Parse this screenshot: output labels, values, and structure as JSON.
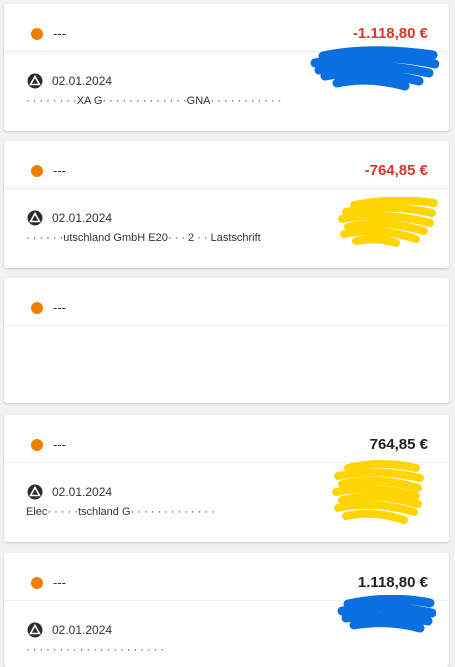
{
  "colors": {
    "status_dot": "#ef7d00",
    "negative": "#d9342b",
    "positive": "#222222",
    "redaction_blue": "#0a6fe0",
    "redaction_yellow": "#ffd400"
  },
  "transactions": [
    {
      "description": "---",
      "amount": "-1.118,80 €",
      "sign": "negative",
      "date": "02.01.2024",
      "bank_icon": "sparkasse-logo-icon",
      "subtext": "· · · · · ·  · ·XA G·  ·  ·  · · ·  ·  ·  ·  · ·  · ·GNA·  ·  ·  · ·  ·  · · ·  ·  ·",
      "redaction": "blue-scribble"
    },
    {
      "description": "---",
      "amount": "-764,85 €",
      "sign": "negative",
      "date": "02.01.2024",
      "bank_icon": "sparkasse-logo-icon",
      "subtext": "· ·  ·  ·  ·  ·utschland GmbH E20·  ·  · 2 · · Lastschrift",
      "redaction": "yellow-scribble"
    },
    {
      "description": "---",
      "amount": "",
      "sign": "none",
      "date": "",
      "bank_icon": "",
      "subtext": "",
      "redaction": "none"
    },
    {
      "description": "---",
      "amount": "764,85 €",
      "sign": "positive",
      "date": "02.01.2024",
      "bank_icon": "sparkasse-logo-icon",
      "subtext": "Elec·  ·  ·  · ·tschland G·  ·  ·  ·  ·  · · · ·  ·  ·  ·  ·",
      "redaction": "yellow-scribble"
    },
    {
      "description": "---",
      "amount": "1.118,80 €",
      "sign": "positive",
      "date": "02.01.2024",
      "bank_icon": "sparkasse-logo-icon",
      "subtext": "· ·  ·  ·  ·  ·  ·  ·  ·  · ·  ·  ·  ·  ·  · ·  ·  ·  ·  ·",
      "redaction": "blue-scribble"
    }
  ]
}
